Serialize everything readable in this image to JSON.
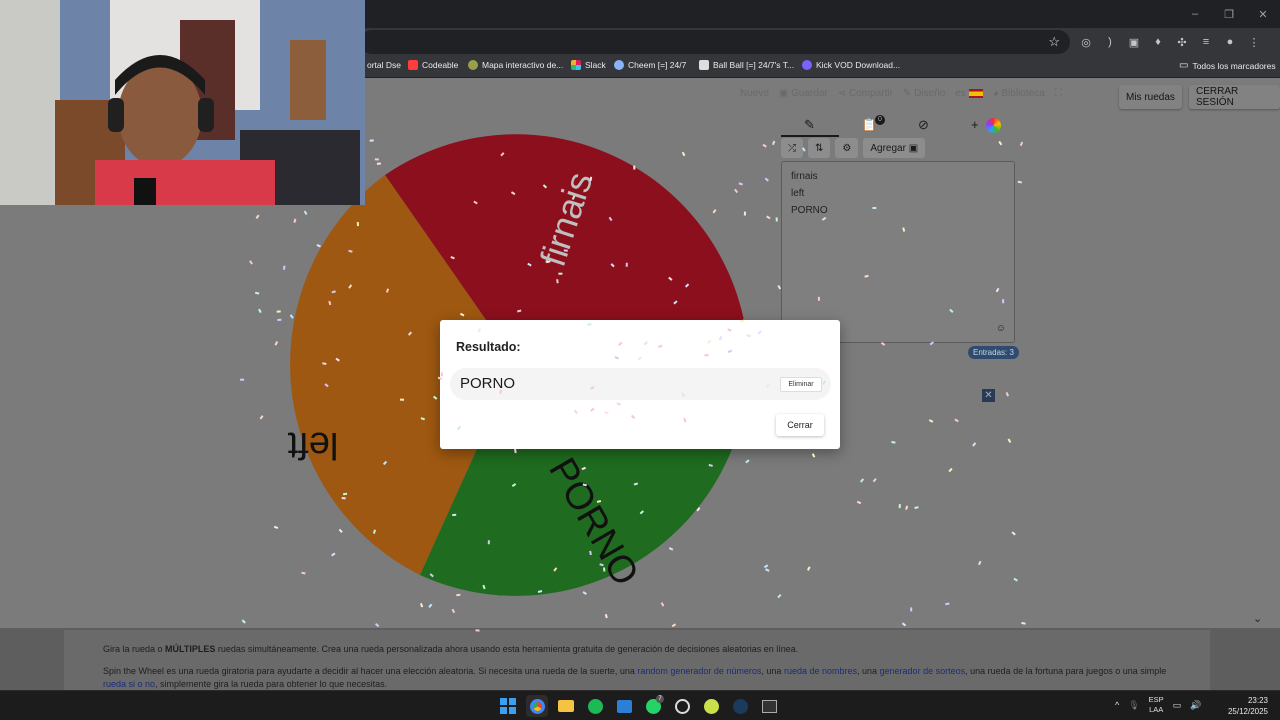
{
  "browser": {
    "window_controls": [
      "–",
      "❐",
      "✕"
    ],
    "bookmarks": [
      {
        "label": "ortal Dse",
        "color": "#8ab4f8"
      },
      {
        "label": "Codeable",
        "color": "#ff3d3d"
      },
      {
        "label": "Mapa interactivo de...",
        "color": "#9aa04a"
      },
      {
        "label": "Slack",
        "color": "#e01e5a"
      },
      {
        "label": "Cheem [=] 24/7",
        "color": "#8ab4f8"
      },
      {
        "label": "Ball Ball [=] 24/7's T...",
        "color": "#dddddd"
      },
      {
        "label": "Kick VOD Download...",
        "color": "#7b61ff"
      }
    ],
    "all_bookmarks": "Todos los marcadores"
  },
  "nav": {
    "nuevo": "Nuevo",
    "guardar": "Guardar",
    "compartir": "Compartir",
    "diseno": "Diseño",
    "lang": "es",
    "biblioteca": "Biblioteca",
    "mis_ruedas": "Mis ruedas",
    "cerrar_sesion": "CERRAR SESIÓN"
  },
  "wheel": {
    "segments": [
      {
        "label": "firnais",
        "color": "#8b0f1c"
      },
      {
        "label": "left",
        "color": "#9e5811"
      },
      {
        "label": "PORNO",
        "color": "#1f6b1f"
      }
    ]
  },
  "editor": {
    "agregar": "Agregar",
    "entries": [
      "firnais",
      "left",
      "PORNO"
    ],
    "entradas": "Entradas: 3",
    "count_badge": "0"
  },
  "dialog": {
    "title": "Resultado:",
    "result": "PORNO",
    "eliminar": "Eliminar",
    "cerrar": "Cerrar"
  },
  "description": {
    "line1_pre": "Gira la rueda o ",
    "line1_bold": "MÚLTIPLES",
    "line1_post": " ruedas simultáneamente. Crea una rueda personalizada ahora usando esta herramienta gratuita de generación de decisiones aleatorias en línea.",
    "line2_a": "Spin the Wheel es una rueda giratoria para ayudarte a decidir al hacer una elección aleatoria. Si necesita una rueda de la suerte, una ",
    "link1": "random generador de números",
    "line2_b": ", una ",
    "link2": "rueda de nombres",
    "line2_c": ", una ",
    "link3": "generador de sorteos",
    "line2_d": ", una rueda de la fortuna para juegos o una simple ",
    "link4": "rueda si o no",
    "line2_e": ", simplemente gira la rueda para obtener lo que necesitas."
  },
  "taskbar": {
    "lang_top": "ESP",
    "lang_bottom": "LAA",
    "time": "23:23",
    "date": "25/12/2025",
    "whatsapp_badge": "7"
  }
}
